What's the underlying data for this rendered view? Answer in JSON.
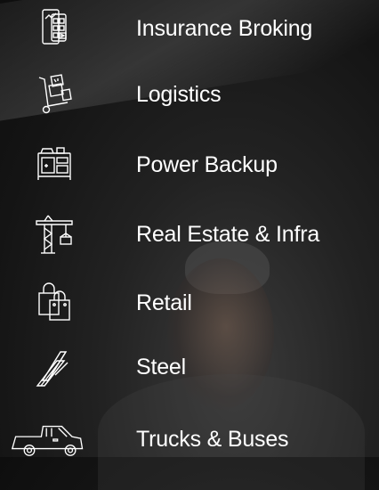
{
  "segments": [
    {
      "label": "Insurance Broking",
      "icon": "insurance-document-icon"
    },
    {
      "label": "Logistics",
      "icon": "hand-truck-boxes-icon"
    },
    {
      "label": "Power Backup",
      "icon": "generator-icon"
    },
    {
      "label": "Real Estate & Infra",
      "icon": "construction-crane-icon"
    },
    {
      "label": "Retail",
      "icon": "shopping-bags-icon"
    },
    {
      "label": "Steel",
      "icon": "steel-beams-icon"
    },
    {
      "label": "Trucks & Buses",
      "icon": "pickup-truck-icon"
    }
  ]
}
